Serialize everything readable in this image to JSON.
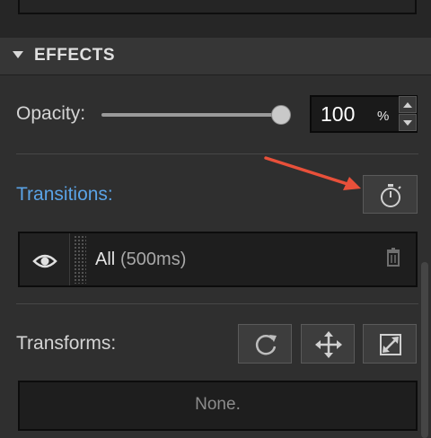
{
  "effects": {
    "title": "EFFECTS",
    "opacity": {
      "label": "Opacity:",
      "value": "100",
      "unit": "%",
      "slider_fraction": 1.0
    }
  },
  "transitions": {
    "label": "Transitions:",
    "items": [
      {
        "name": "All",
        "duration": "(500ms)"
      }
    ]
  },
  "transforms": {
    "label": "Transforms:",
    "empty_text": "None."
  },
  "colors": {
    "accent_label": "#5aa3e6",
    "annotation_arrow": "#e8503a"
  },
  "icons": [
    "chevron-down-icon",
    "stopwatch-icon",
    "eye-icon",
    "drag-handle-icon",
    "trash-icon",
    "reset-icon",
    "move-icon",
    "scale-icon"
  ]
}
